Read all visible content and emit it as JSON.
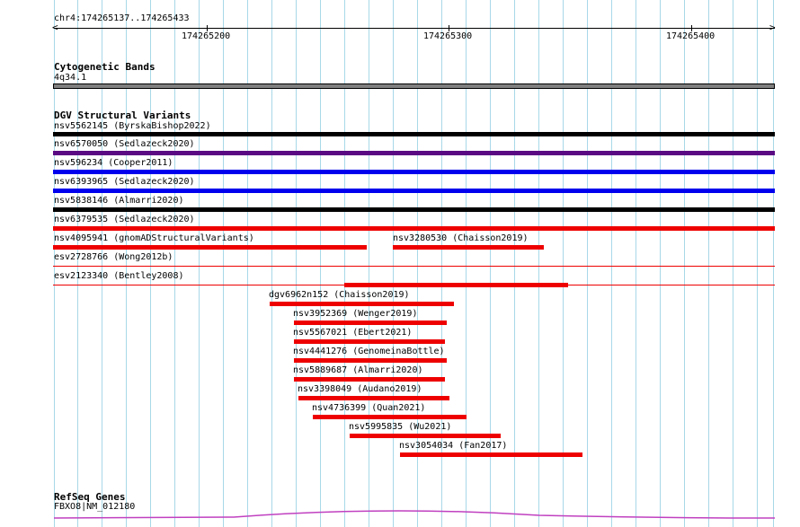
{
  "ruler": {
    "location": "chr4:174265137..174265433",
    "ticks": [
      "174265200",
      "174265300",
      "174265400"
    ]
  },
  "cytoband": {
    "title": "Cytogenetic Bands",
    "band": "4q34.1",
    "color": "#808080"
  },
  "dgv": {
    "title": "DGV Structural Variants",
    "colors": {
      "black": "#000000",
      "purple": "#5a0a82",
      "blue": "#0000ee",
      "red": "#ee0000"
    },
    "features": [
      {
        "name": "nsv5562145 (ByrskaBishop2022)",
        "color": "black"
      },
      {
        "name": "nsv6570050 (Sedlazeck2020)",
        "color": "purple"
      },
      {
        "name": "nsv596234 (Cooper2011)",
        "color": "blue"
      },
      {
        "name": "nsv6393965 (Sedlazeck2020)",
        "color": "blue"
      },
      {
        "name": "nsv5838146 (Almarri2020)",
        "color": "black"
      },
      {
        "name": "nsv6379535 (Sedlazeck2020)",
        "color": "red"
      },
      {
        "name": "nsv4095941 (gnomADStructuralVariants)",
        "color": "red"
      },
      {
        "name": "nsv3280530 (Chaisson2019)",
        "color": "red"
      },
      {
        "name": "esv2728766 (Wong2012b)",
        "color": "red"
      },
      {
        "name": "esv2123340 (Bentley2008)",
        "color": "red"
      },
      {
        "name": "",
        "color": "red"
      },
      {
        "name": "dgv6962n152 (Chaisson2019)",
        "color": "red"
      },
      {
        "name": "nsv3952369 (Wenger2019)",
        "color": "red"
      },
      {
        "name": "nsv5567021 (Ebert2021)",
        "color": "red"
      },
      {
        "name": "nsv4441276 (GenomeinaBottle)",
        "color": "red"
      },
      {
        "name": "nsv5889687 (Almarri2020)",
        "color": "red"
      },
      {
        "name": "nsv3398049 (Audano2019)",
        "color": "red"
      },
      {
        "name": "nsv4736399 (Quan2021)",
        "color": "red"
      },
      {
        "name": "nsv5995835 (Wu2021)",
        "color": "red"
      },
      {
        "name": "nsv3054034 (Fan2017)",
        "color": "red"
      }
    ]
  },
  "refseq": {
    "title": "RefSeq Genes",
    "gene": "FBXO8|NM_012180",
    "color": "#c040c0"
  }
}
